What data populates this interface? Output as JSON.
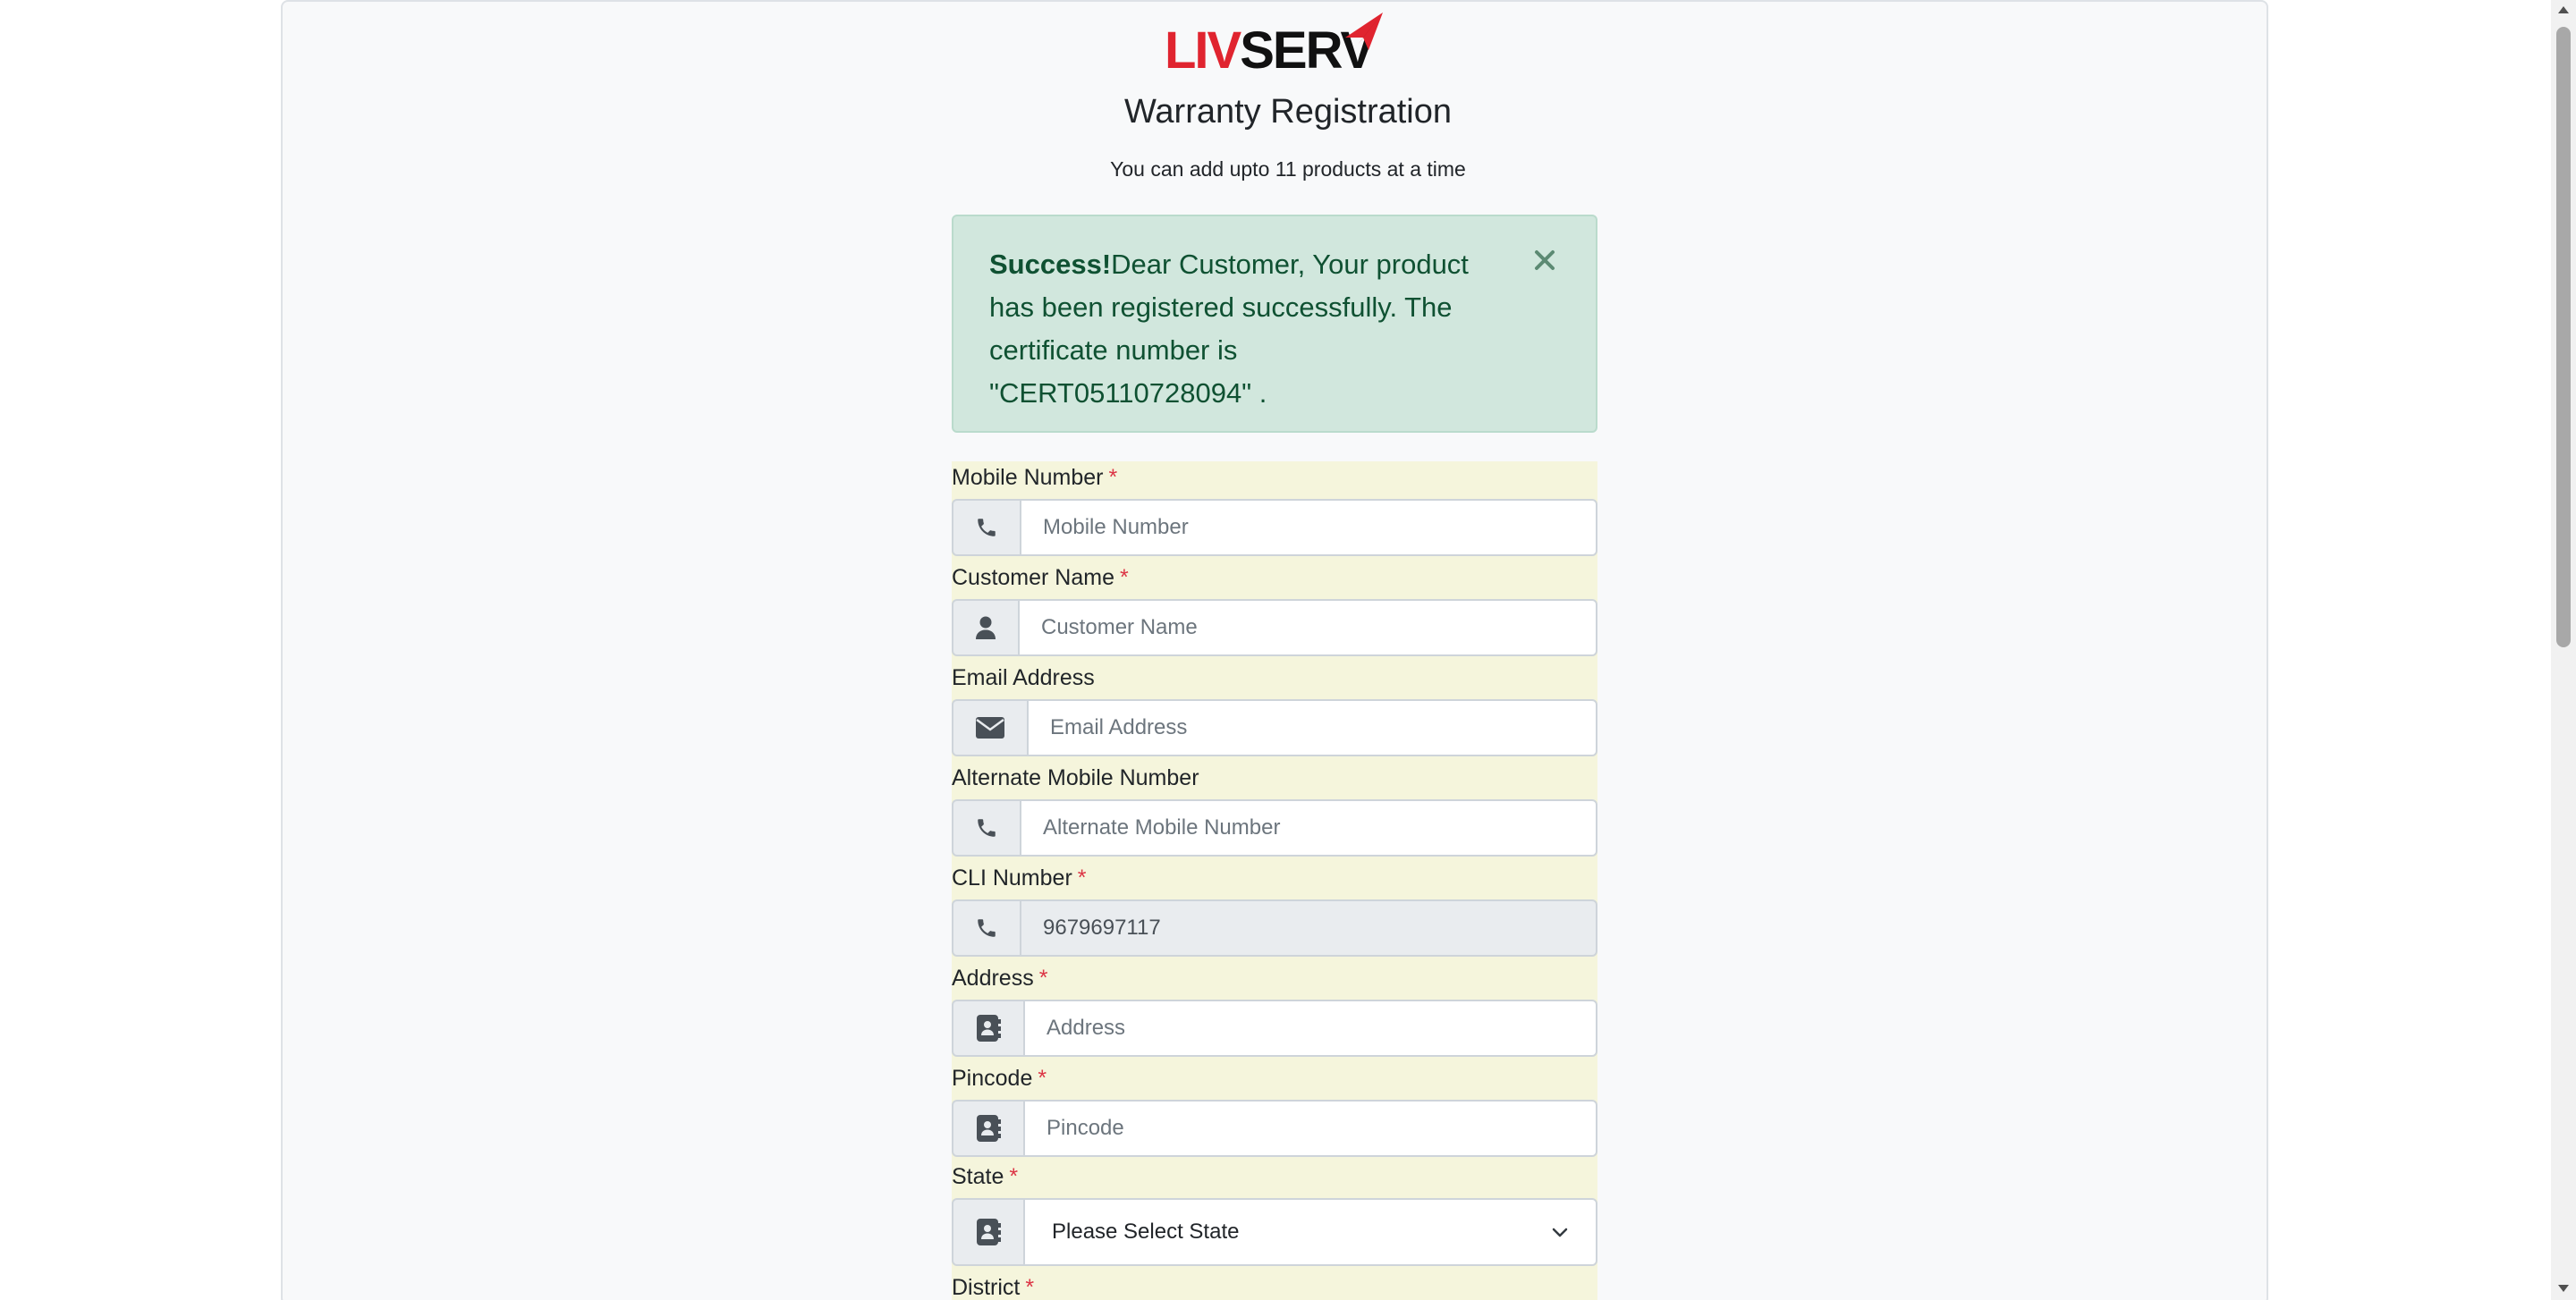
{
  "brand": {
    "logo_part1": "LIV",
    "logo_part2": "SERV"
  },
  "header": {
    "title": "Warranty Registration",
    "subtitle": "You can add upto 11 products at a time"
  },
  "alert": {
    "strong": "Success!",
    "message": "Dear Customer, Your product has been registered successfully. The certificate number is \"CERT05110728094\" ."
  },
  "form": {
    "mobile": {
      "label": "Mobile Number",
      "required": "*",
      "placeholder": "Mobile Number",
      "icon": "phone-icon"
    },
    "customer_name": {
      "label": "Customer Name",
      "required": "*",
      "placeholder": "Customer Name",
      "icon": "user-icon"
    },
    "email": {
      "label": "Email Address",
      "placeholder": "Email Address",
      "icon": "envelope-icon"
    },
    "alt_mobile": {
      "label": "Alternate Mobile Number",
      "placeholder": "Alternate Mobile Number",
      "icon": "phone-icon"
    },
    "cli": {
      "label": "CLI Number",
      "required": "*",
      "value": "9679697117",
      "icon": "phone-icon"
    },
    "address": {
      "label": "Address",
      "required": "*",
      "placeholder": "Address",
      "icon": "address-book-icon"
    },
    "pincode": {
      "label": "Pincode",
      "required": "*",
      "placeholder": "Pincode",
      "icon": "address-book-icon"
    },
    "state": {
      "label": "State",
      "required": "*",
      "selected": "Please Select State",
      "icon": "address-book-icon"
    },
    "district": {
      "label": "District",
      "required": "*"
    }
  },
  "colors": {
    "success_bg": "#d1e7dd",
    "success_text": "#0f5132",
    "form_bg": "#f5f5dc",
    "required": "#dc3545",
    "logo_red": "#e0242f"
  }
}
